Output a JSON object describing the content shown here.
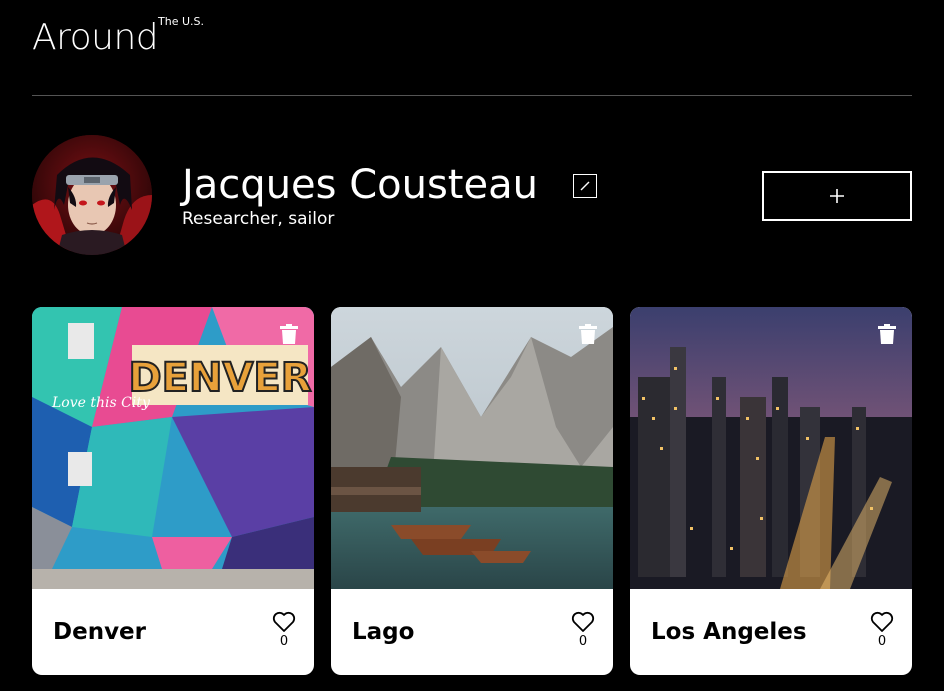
{
  "header": {
    "logo": "Around",
    "logo_sup": "The U.S."
  },
  "profile": {
    "name": "Jacques Cousteau",
    "about": "Researcher, sailor",
    "avatar_icon": "avatar-image",
    "edit_icon": "pencil-icon",
    "add_icon": "plus-icon"
  },
  "cards": [
    {
      "title": "Denver",
      "likes": "0",
      "image": "denver-mural-photo"
    },
    {
      "title": "Lago",
      "likes": "0",
      "image": "lake-mountains-photo"
    },
    {
      "title": "Los Angeles",
      "likes": "0",
      "image": "los-angeles-skyline-photo"
    }
  ],
  "colors": {
    "background": "#000000",
    "text": "#ffffff",
    "card": "#ffffff",
    "divider": "#545454"
  }
}
